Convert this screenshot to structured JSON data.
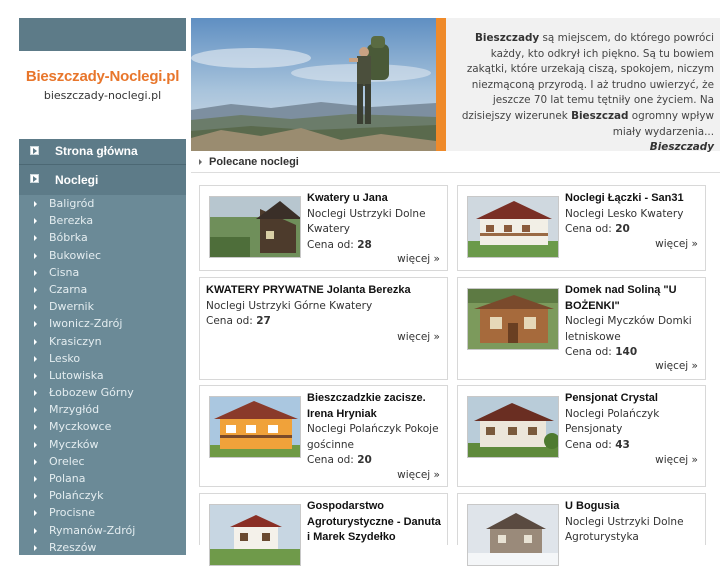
{
  "logo": {
    "title": "Bieszczady-Noclegi.pl",
    "subtitle": "bieszczady-noclegi.pl"
  },
  "nav": {
    "main": [
      {
        "label": "Strona główna"
      },
      {
        "label": "Noclegi"
      }
    ],
    "towns": [
      "Baligród",
      "Berezka",
      "Bóbrka",
      "Bukowiec",
      "Cisna",
      "Czarna",
      "Dwernik",
      "Iwonicz-Zdrój",
      "Krasiczyn",
      "Lesko",
      "Lutowiska",
      "Łobozew Górny",
      "Mrzygłód",
      "Myczkowce",
      "Myczków",
      "Orelec",
      "Polana",
      "Polańczyk",
      "Procisne",
      "Rymanów-Zdrój",
      "Rzeszów"
    ]
  },
  "intro": {
    "lead": "Bieszczady",
    "text": " są miejscem, do którego powróci każdy, kto odkrył ich piękno. Są tu bowiem zakątki, które urzekają ciszą, spokojem, niczym niezmąconą przyrodą. I aż trudno uwierzyć, że jeszcze 70 lat temu tętniły one życiem. Na dzisiejszy wizerunek ",
    "lead2": "Bieszczad",
    "text2": " ogromny wpływ miały wydarzenia...",
    "signature": "Bieszczady"
  },
  "section": {
    "title": "Polecane noclegi"
  },
  "listings": [
    {
      "name": "Kwatery u Jana",
      "category": "Noclegi Ustrzyki Dolne Kwatery",
      "price_label": "Cena od:",
      "price": "28",
      "more": "więcej »"
    },
    {
      "name": "Noclegi Łączki - San31",
      "category": "Noclegi Lesko Kwatery",
      "price_label": "Cena od:",
      "price": "20",
      "more": "więcej »"
    },
    {
      "name": "KWATERY PRYWATNE Jolanta Berezka",
      "category": "Noclegi Ustrzyki Górne Kwatery",
      "price_label": "Cena od:",
      "price": "27",
      "more": "więcej »"
    },
    {
      "name": "Domek nad Soliną \"U BOŻENKI\"",
      "category": "Noclegi Myczków Domki letniskowe",
      "price_label": "Cena od:",
      "price": "140",
      "more": "więcej »"
    },
    {
      "name": "Bieszczadzkie zacisze. Irena Hryniak",
      "category": "Noclegi Polańczyk Pokoje gościnne",
      "price_label": "Cena od:",
      "price": "20",
      "more": "więcej »"
    },
    {
      "name": "Pensjonat Crystal",
      "category": "Noclegi Polańczyk Pensjonaty",
      "price_label": "Cena od:",
      "price": "43",
      "more": "więcej »"
    },
    {
      "name": "Gospodarstwo Agroturystyczne - Danuta i Marek Szydełko",
      "category": "",
      "price_label": "",
      "price": "",
      "more": ""
    },
    {
      "name": "U Bogusia",
      "category": "Noclegi Ustrzyki Dolne Agroturystyka",
      "price_label": "",
      "price": "",
      "more": ""
    }
  ],
  "icons": {
    "nav_bullet": "square-arrow-icon",
    "town_bullet": "triangle-arrow-icon"
  },
  "colors": {
    "accent": "#e8762b",
    "sidebar": "#5d7b88",
    "sidebar_list": "#6b8a97",
    "bar": "#ef8a2a"
  }
}
